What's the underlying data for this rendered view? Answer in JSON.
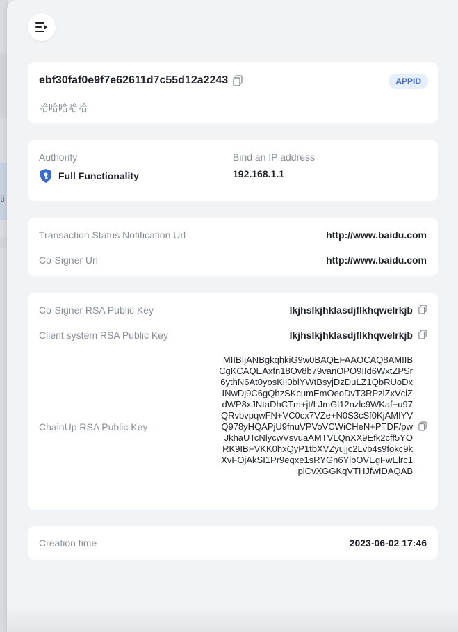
{
  "backdrop": {
    "peek_text": "ti"
  },
  "app": {
    "app_id": "ebf30faf0e9f7e62611d7c55d12a2243",
    "badge": "APPID",
    "name": "哈哈哈哈哈"
  },
  "authority": {
    "label": "Authority",
    "value": "Full Functionality",
    "icon": "shield-key-icon",
    "ip_label": "Bind an IP address",
    "ip_value": "192.168.1.1"
  },
  "urls": {
    "notify_label": "Transaction Status Notification Url",
    "notify_value": "http://www.baidu.com",
    "cosigner_label": "Co-Signer Url",
    "cosigner_value": "http://www.baidu.com"
  },
  "keys": {
    "cosigner_label": "Co-Signer RSA Public Key",
    "cosigner_value": "lkjhslkjhklasdjflkhqwelrkjb",
    "client_label": "Client system RSA Public Key",
    "client_value": "lkjhslkjhklasdjflkhqwelrkjb",
    "chainup_label": "ChainUp RSA Public Key",
    "chainup_value": "MIIBIjANBgkqhkiG9w0BAQEFAAOCAQ8AMIIBCgKCAQEAxfn18Ov8b79vanOPO9IId6WxtZPSr6ythN6At0yosKlI0blYWtBsyjDzDuLZ1QbRUoDxINwDj9C6gQhzSKcumEmOeoDvT3RPzlZxVciZdWP8xJNtaDhCTm+jt/LJmGl12nzlc9WKaf+u97QRvbvpqwFN+VC0cx7VZe+N0S3cSf0KjAMIYVQ978yHQAPjU9fnuVPVoVCWiCHeN+PTDF/pwJkhaUTcNlycwVsvuaAMTVLQnXX9Efk2cff5YORK9IBFVKK0hxQyP1tbXVZyujjc2Lvb4s9fokc9kXvFOjAkSI1Pr9eqxe1sRYGh6YlbOVEgFwElrc1plCvXGGKqVTHJfwIDAQAB"
  },
  "created": {
    "label": "Creation time",
    "value": "2023-06-02 17:46"
  },
  "colors": {
    "accent": "#3a6ad6",
    "badge_bg": "#e6efff",
    "muted": "#8a9099"
  }
}
